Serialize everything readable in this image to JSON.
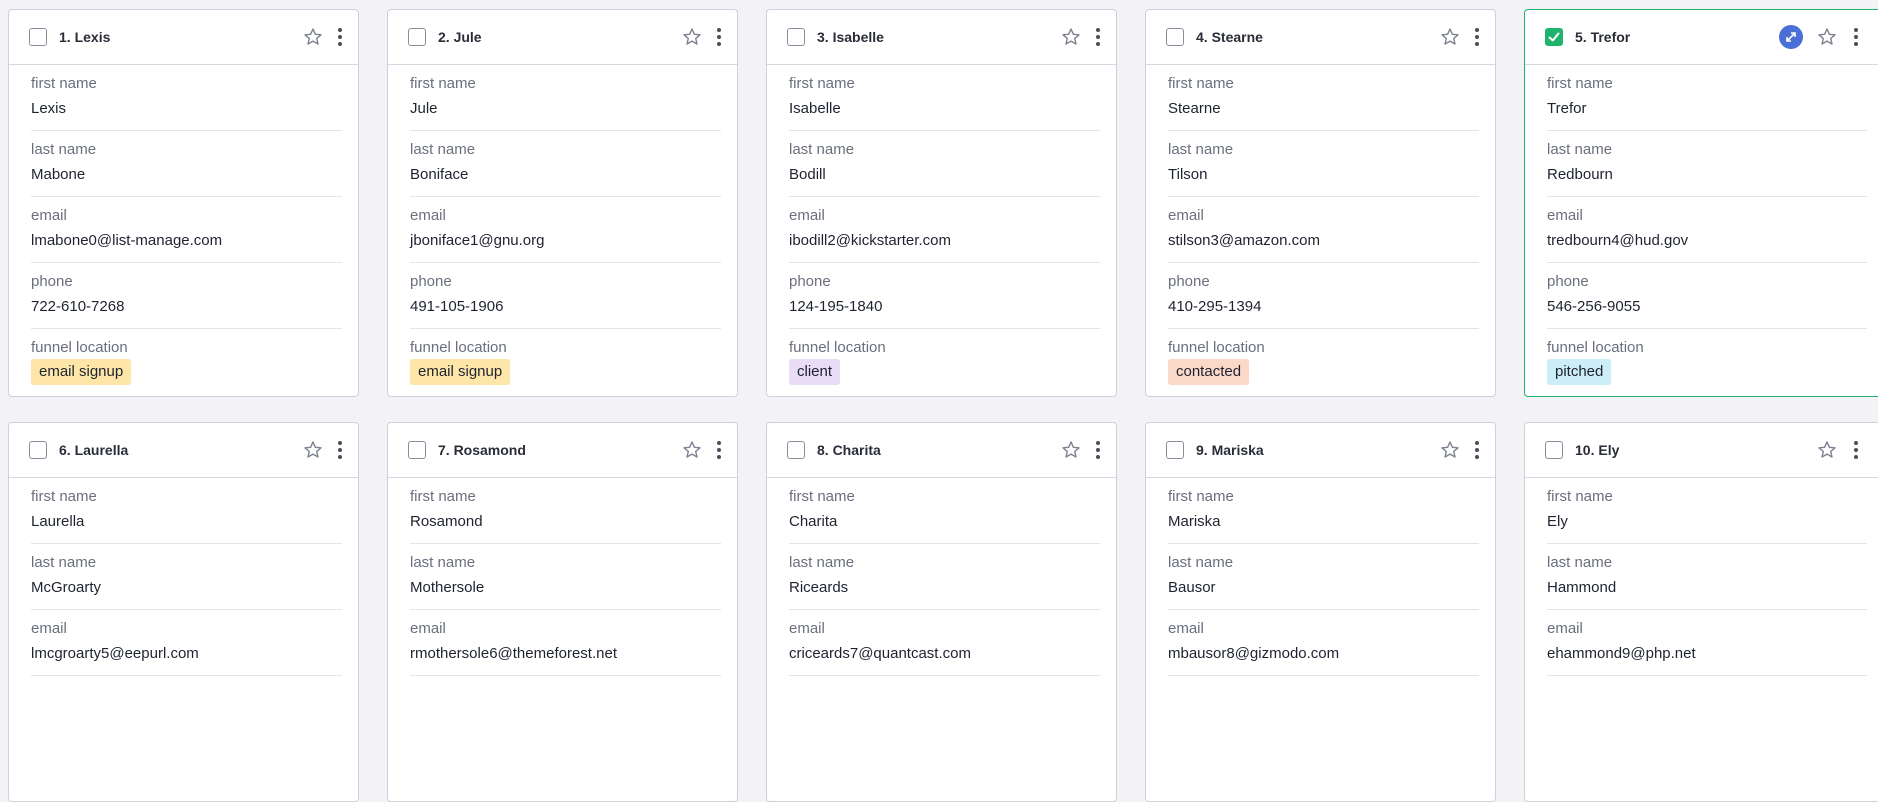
{
  "colors": {
    "accent_green": "#1fb36b",
    "expand_blue": "#4a6fd6",
    "email_signup": "#fde6a8",
    "client": "#e8dcf7",
    "contacted": "#fbd9c9",
    "pitched": "#cceef7"
  },
  "labels": {
    "first_name": "first name",
    "last_name": "last name",
    "email": "email",
    "phone": "phone",
    "funnel_location": "funnel location"
  },
  "cards": [
    {
      "title": "1. Lexis",
      "first_name": "Lexis",
      "last_name": "Mabone",
      "email": "lmabone0@list-manage.com",
      "phone": "722-610-7268",
      "funnel": "email signup",
      "funnel_color": "#fde6a8",
      "checked": false
    },
    {
      "title": "2. Jule",
      "first_name": "Jule",
      "last_name": "Boniface",
      "email": "jboniface1@gnu.org",
      "phone": "491-105-1906",
      "funnel": "email signup",
      "funnel_color": "#fde6a8",
      "checked": false
    },
    {
      "title": "3. Isabelle",
      "first_name": "Isabelle",
      "last_name": "Bodill",
      "email": "ibodill2@kickstarter.com",
      "phone": "124-195-1840",
      "funnel": "client",
      "funnel_color": "#e8dcf7",
      "checked": false
    },
    {
      "title": "4. Stearne",
      "first_name": "Stearne",
      "last_name": "Tilson",
      "email": "stilson3@amazon.com",
      "phone": "410-295-1394",
      "funnel": "contacted",
      "funnel_color": "#fbd9c9",
      "checked": false
    },
    {
      "title": "5. Trefor",
      "first_name": "Trefor",
      "last_name": "Redbourn",
      "email": "tredbourn4@hud.gov",
      "phone": "546-256-9055",
      "funnel": "pitched",
      "funnel_color": "#cceef7",
      "checked": true
    },
    {
      "title": "6. Laurella",
      "first_name": "Laurella",
      "last_name": "McGroarty",
      "email": "lmcgroarty5@eepurl.com",
      "checked": false
    },
    {
      "title": "7. Rosamond",
      "first_name": "Rosamond",
      "last_name": "Mothersole",
      "email": "rmothersole6@themeforest.net",
      "checked": false
    },
    {
      "title": "8. Charita",
      "first_name": "Charita",
      "last_name": "Riceards",
      "email": "criceards7@quantcast.com",
      "checked": false
    },
    {
      "title": "9. Mariska",
      "first_name": "Mariska",
      "last_name": "Bausor",
      "email": "mbausor8@gizmodo.com",
      "checked": false
    },
    {
      "title": "10. Ely",
      "first_name": "Ely",
      "last_name": "Hammond",
      "email": "ehammond9@php.net",
      "checked": false
    }
  ]
}
